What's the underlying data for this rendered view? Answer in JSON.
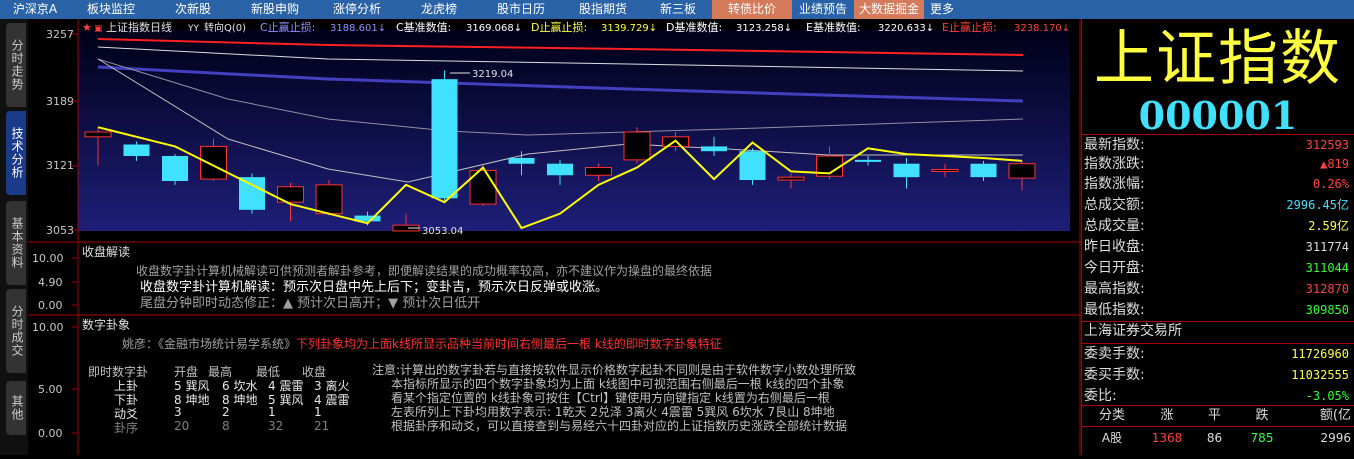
{
  "top_tabs": [
    "沪深京A",
    "板块监控",
    "次新股",
    "新股申购",
    "涨停分析",
    "龙虎榜",
    "股市日历",
    "股指期货",
    "新三板",
    "转债比价",
    "业绩预告",
    "大数据掘金",
    "更多"
  ],
  "side_tabs": [
    "分时走势",
    "技术分析",
    "基本资料",
    "分时成交",
    "其他"
  ],
  "chart": {
    "title": "上证指数日线",
    "flag": "YY",
    "mode": "转向Q(0)",
    "c_label": "C止赢止损:",
    "c_val": "3188.601↓",
    "cb_label": "C基准数值:",
    "cb_val": "3169.068↓",
    "d_label": "D止赢止损:",
    "d_val": "3139.729↓",
    "db_label": "D基准数值:",
    "db_val": "3123.258↓",
    "e_label": "E基准数值:",
    "e_val": "3220.633↓",
    "es_label": "E止赢止损:",
    "es_val": "3238.170↓",
    "hi_label": "3219.04",
    "lo_label": "3053.04"
  },
  "chart_data": {
    "type": "candlestick",
    "y_ticks": [
      "3257",
      "3189",
      "3121",
      "3053"
    ],
    "ylim": [
      3045,
      3265
    ],
    "candles": [
      {
        "o": 3150,
        "c": 3155,
        "h": 3160,
        "l": 3120
      },
      {
        "o": 3142,
        "c": 3130,
        "h": 3145,
        "l": 3125
      },
      {
        "o": 3130,
        "c": 3104,
        "h": 3132,
        "l": 3100
      },
      {
        "o": 3106,
        "c": 3140,
        "h": 3148,
        "l": 3104
      },
      {
        "o": 3108,
        "c": 3074,
        "h": 3112,
        "l": 3070
      },
      {
        "o": 3082,
        "c": 3098,
        "h": 3102,
        "l": 3062
      },
      {
        "o": 3070,
        "c": 3100,
        "h": 3105,
        "l": 3068
      },
      {
        "o": 3068,
        "c": 3062,
        "h": 3072,
        "l": 3058
      },
      {
        "o": 3052,
        "c": 3058,
        "h": 3070,
        "l": 3052
      },
      {
        "o": 3210,
        "c": 3086,
        "h": 3219,
        "l": 3082
      },
      {
        "o": 3080,
        "c": 3115,
        "h": 3120,
        "l": 3078
      },
      {
        "o": 3128,
        "c": 3122,
        "h": 3135,
        "l": 3110
      },
      {
        "o": 3122,
        "c": 3110,
        "h": 3126,
        "l": 3100
      },
      {
        "o": 3110,
        "c": 3118,
        "h": 3122,
        "l": 3104
      },
      {
        "o": 3126,
        "c": 3155,
        "h": 3160,
        "l": 3122
      },
      {
        "o": 3140,
        "c": 3150,
        "h": 3155,
        "l": 3135
      },
      {
        "o": 3140,
        "c": 3135,
        "h": 3150,
        "l": 3130
      },
      {
        "o": 3135,
        "c": 3105,
        "h": 3138,
        "l": 3100
      },
      {
        "o": 3105,
        "c": 3108,
        "h": 3112,
        "l": 3096
      },
      {
        "o": 3109,
        "c": 3130,
        "h": 3140,
        "l": 3106
      },
      {
        "o": 3126,
        "c": 3124,
        "h": 3130,
        "l": 3120
      },
      {
        "o": 3122,
        "c": 3108,
        "h": 3128,
        "l": 3096
      },
      {
        "o": 3114,
        "c": 3116,
        "h": 3122,
        "l": 3108
      },
      {
        "o": 3122,
        "c": 3108,
        "h": 3125,
        "l": 3104
      },
      {
        "o": 3107,
        "c": 3122,
        "h": 3125,
        "l": 3094
      }
    ],
    "yellow_line": [
      3160,
      3150,
      3140,
      3120,
      3100,
      3080,
      3070,
      3060,
      3100,
      3082,
      3118,
      3055,
      3070,
      3100,
      3118,
      3146,
      3106,
      3144,
      3114,
      3112,
      3138,
      3132,
      3130,
      3128,
      3125
    ]
  },
  "panel1": {
    "title": "收盘解读",
    "ticks": [
      "10.00",
      "4.90",
      "0.00"
    ],
    "l1": "收盘数字卦计算机械解读可供预测者解卦参考，即便解读结果的成功概率较高，亦不建议作为操盘的最终依据",
    "l2": "收盘数字卦计算机解读：预示次日盘中先上后下；变卦吉，预示次日反弹或收涨。",
    "l3": "尾盘分钟即时动态修正：▲ 预计次日高开；▼ 预计次日低开"
  },
  "panel2": {
    "title": "数字卦象",
    "ticks": [
      "10.00",
      "5.00",
      "0.00"
    ],
    "source": "姚彦：《金融市场统计易学系统》",
    "red_note": "下列卦象均为上面k线所显示品种当前时间右侧最后一根 k线的即时数字卦象特征",
    "hdr": [
      "即时数字卦",
      "开盘",
      "最高",
      "最低",
      "收盘"
    ],
    "r1": [
      "上卦",
      "5 巽风",
      "6 坎水",
      "4 震雷",
      "3 离火"
    ],
    "r2": [
      "下卦",
      "8 坤地",
      "8 坤地",
      "5 巽风",
      "4 震雷"
    ],
    "r3": [
      "动爻",
      "3",
      "2",
      "1",
      "1"
    ],
    "r4": [
      "卦序",
      "20",
      "8",
      "32",
      "21"
    ],
    "notes": [
      "注意:计算出的数字卦若与直接按软件显示价格数字起卦不同则是由于软件数字小数处理所致",
      "本指标所显示的四个数字卦象均为上面 k线图中可视范围右侧最后一根 k线的四个卦象",
      "看某个指定位置的 k线卦象可按住【Ctrl】键使用方向键指定 k线置为右侧最后一根",
      "左表所列上下卦均用数字表示: 1乾天 2兑泽 3离火 4震雷 5巽风 6坎水 7艮山 8坤地",
      "根据卦序和动爻，可以直接查到与易经六十四卦对应的上证指数历史涨跌全部统计数据"
    ]
  },
  "right": {
    "name": "上证指数",
    "code": "000001",
    "rows": [
      [
        "最新指数:",
        "312593"
      ],
      [
        "指数涨跌:",
        "▲819"
      ],
      [
        "指数涨幅:",
        "0.26%"
      ],
      [
        "总成交额:",
        "2996.45亿"
      ],
      [
        "总成交量:",
        "2.59亿"
      ],
      [
        "昨日收盘:",
        "311774"
      ],
      [
        "今日开盘:",
        "311044"
      ],
      [
        "最高指数:",
        "312870"
      ],
      [
        "最低指数:",
        "309850"
      ]
    ],
    "exchange": "上海证券交易所",
    "rows2": [
      [
        "委卖手数:",
        "11726960"
      ],
      [
        "委买手数:",
        "11032555"
      ],
      [
        "委比:",
        "-3.05%"
      ]
    ],
    "table_hdr": [
      "分类",
      "涨",
      "平",
      "跌",
      "额(亿"
    ],
    "table_row": [
      "A股",
      "1368",
      "86",
      "785",
      "2996"
    ]
  }
}
